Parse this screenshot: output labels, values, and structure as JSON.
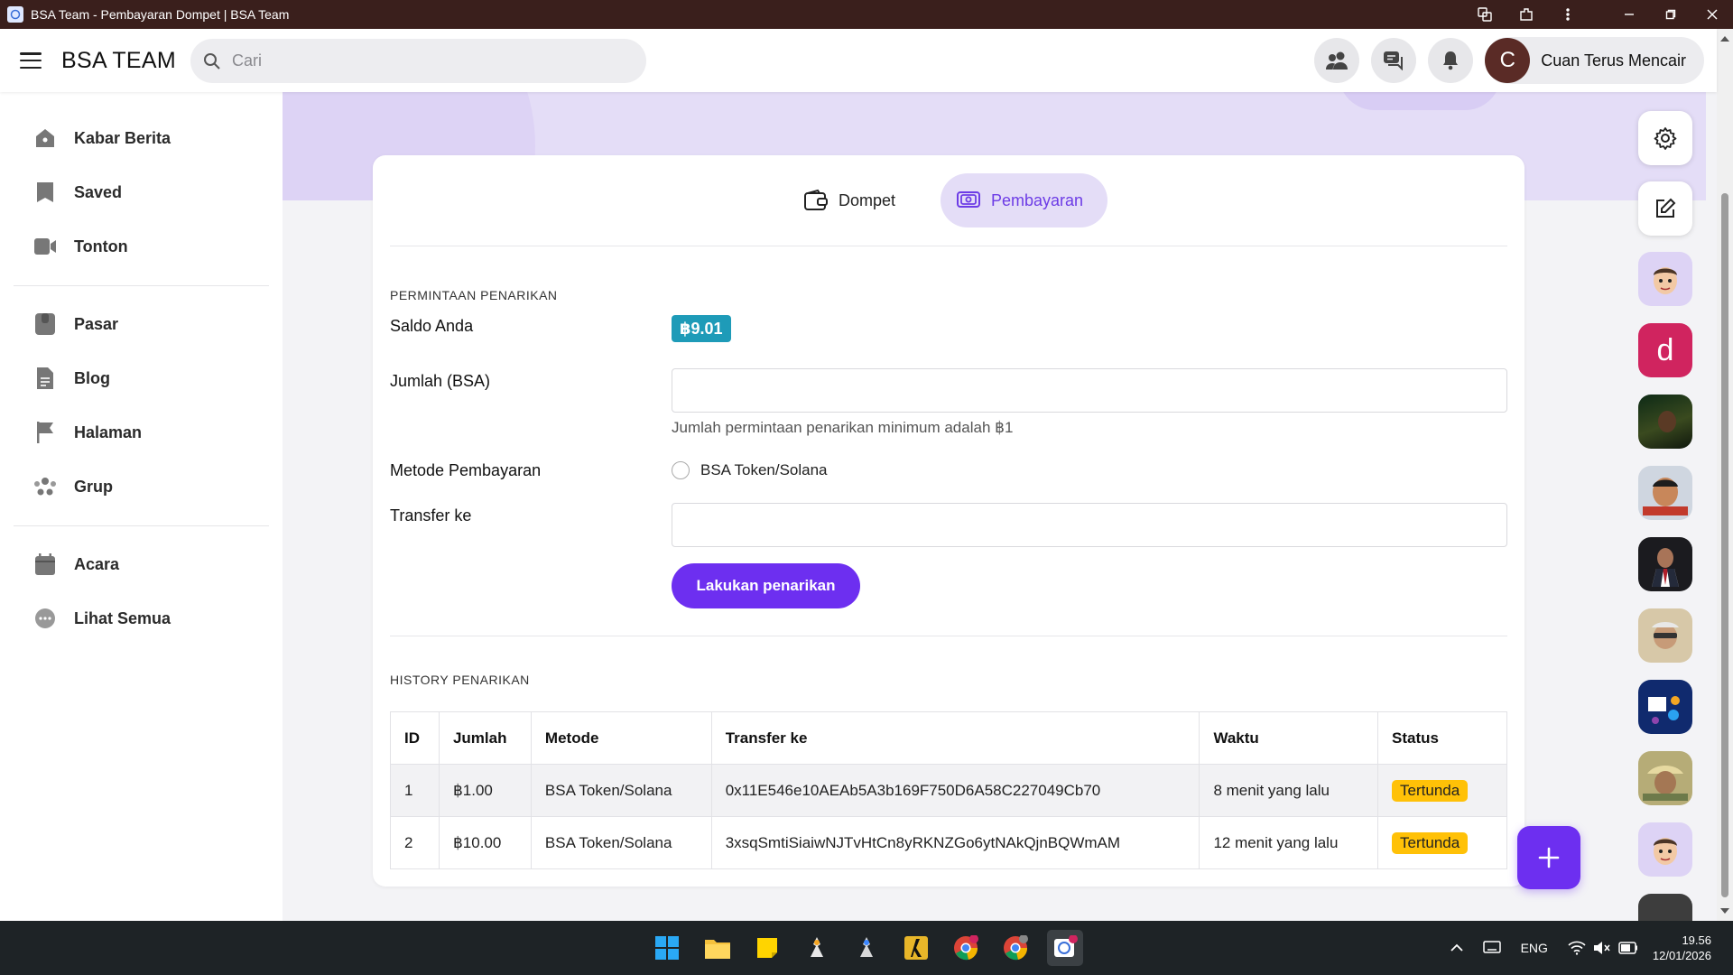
{
  "window": {
    "title": "BSA Team - Pembayaran Dompet | BSA Team"
  },
  "header": {
    "brand": "BSA TEAM",
    "search_placeholder": "Cari",
    "user_initial": "C",
    "user_name": "Cuan Terus Mencair"
  },
  "sidebar": {
    "items": [
      {
        "label": "Kabar Berita",
        "icon": "home-icon"
      },
      {
        "label": "Saved",
        "icon": "bookmark-icon"
      },
      {
        "label": "Tonton",
        "icon": "video-icon"
      },
      {
        "label": "Pasar",
        "icon": "market-icon"
      },
      {
        "label": "Blog",
        "icon": "blog-icon"
      },
      {
        "label": "Halaman",
        "icon": "flag-icon"
      },
      {
        "label": "Grup",
        "icon": "group-icon"
      },
      {
        "label": "Acara",
        "icon": "calendar-icon"
      },
      {
        "label": "Lihat Semua",
        "icon": "more-icon"
      }
    ]
  },
  "tabs": [
    {
      "label": "Dompet",
      "icon": "wallet-icon",
      "active": false
    },
    {
      "label": "Pembayaran",
      "icon": "payment-icon",
      "active": true
    }
  ],
  "withdraw": {
    "section_title": "PERMINTAAN PENARIKAN",
    "balance_label": "Saldo Anda",
    "balance_value": "฿9.01",
    "amount_label": "Jumlah (BSA)",
    "amount_value": "",
    "amount_hint": "Jumlah permintaan penarikan minimum adalah ฿1",
    "method_label": "Metode Pembayaran",
    "method_option": "BSA Token/Solana",
    "transfer_label": "Transfer ke",
    "transfer_value": "",
    "submit_label": "Lakukan penarikan"
  },
  "history": {
    "section_title": "HISTORY PENARIKAN",
    "columns": [
      "ID",
      "Jumlah",
      "Metode",
      "Transfer ke",
      "Waktu",
      "Status"
    ],
    "rows": [
      [
        "1",
        "฿1.00",
        "BSA Token/Solana",
        "0x11E546e10AEAb5A3b169F750D6A58C227049Cb70",
        "8 menit yang lalu",
        "Tertunda"
      ],
      [
        "2",
        "฿10.00",
        "BSA Token/Solana",
        "3xsqSmtiSiaiwNJTvHtCn8yRKNZGo6ytNAkQjnBQWmAM",
        "12 menit yang lalu",
        "Tertunda"
      ]
    ]
  },
  "right_rail": {
    "avatar_letter": "d"
  },
  "taskbar": {
    "lang": "ENG",
    "time": "19.56",
    "date": "12/01/2026"
  },
  "colors": {
    "accent": "#6d2ff0",
    "accent_soft": "#e4ddf7",
    "balance_badge": "#1e9bb8",
    "status_pending": "#ffc107",
    "titlebar": "#3a1f1c",
    "taskbar": "#1e2326"
  }
}
